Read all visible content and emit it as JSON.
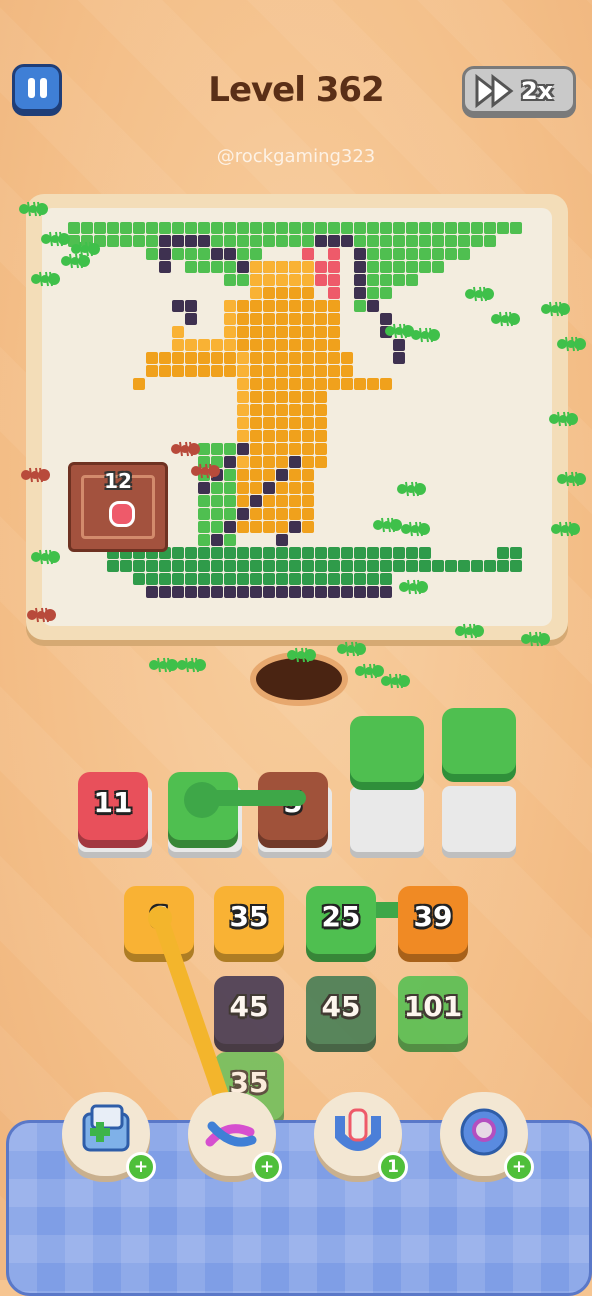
{
  "header": {
    "level_title": "Level 362",
    "speed_label": "2x",
    "watermark": "@rockgaming323"
  },
  "board": {
    "crate_count": "12"
  },
  "queue": [
    {
      "label": "11",
      "color": "#e8505b"
    },
    {
      "label": "",
      "color": "#4fbf50"
    },
    {
      "label": "5",
      "color": "#a0523a"
    }
  ],
  "tiles_row1": [
    {
      "label": "6",
      "color": "#f9b234"
    },
    {
      "label": "35",
      "color": "#f9b234"
    },
    {
      "label": "25",
      "color": "#4fbf50"
    },
    {
      "label": "39",
      "color": "#f08a24"
    }
  ],
  "tiles_row2": [
    {
      "label": "45",
      "color": "#3d3350"
    },
    {
      "label": "45",
      "color": "#3d7a52"
    },
    {
      "label": "101",
      "color": "#4fbf50"
    }
  ],
  "tiles_row3": [
    {
      "label": "35",
      "color": "#4fbf50"
    }
  ],
  "boosters": [
    {
      "icon": "add-slot-icon",
      "badge": "+"
    },
    {
      "icon": "shuffle-icon",
      "badge": "+"
    },
    {
      "icon": "magnet-icon",
      "badge": "1"
    },
    {
      "icon": "bomb-icon",
      "badge": "+"
    }
  ],
  "colors": {
    "green": "#4fbf50",
    "dark_green": "#2f9b4a",
    "orange": "#f0a11c",
    "light_orange": "#f9b234",
    "purple": "#3e3150",
    "pink": "#ee5a6a"
  }
}
